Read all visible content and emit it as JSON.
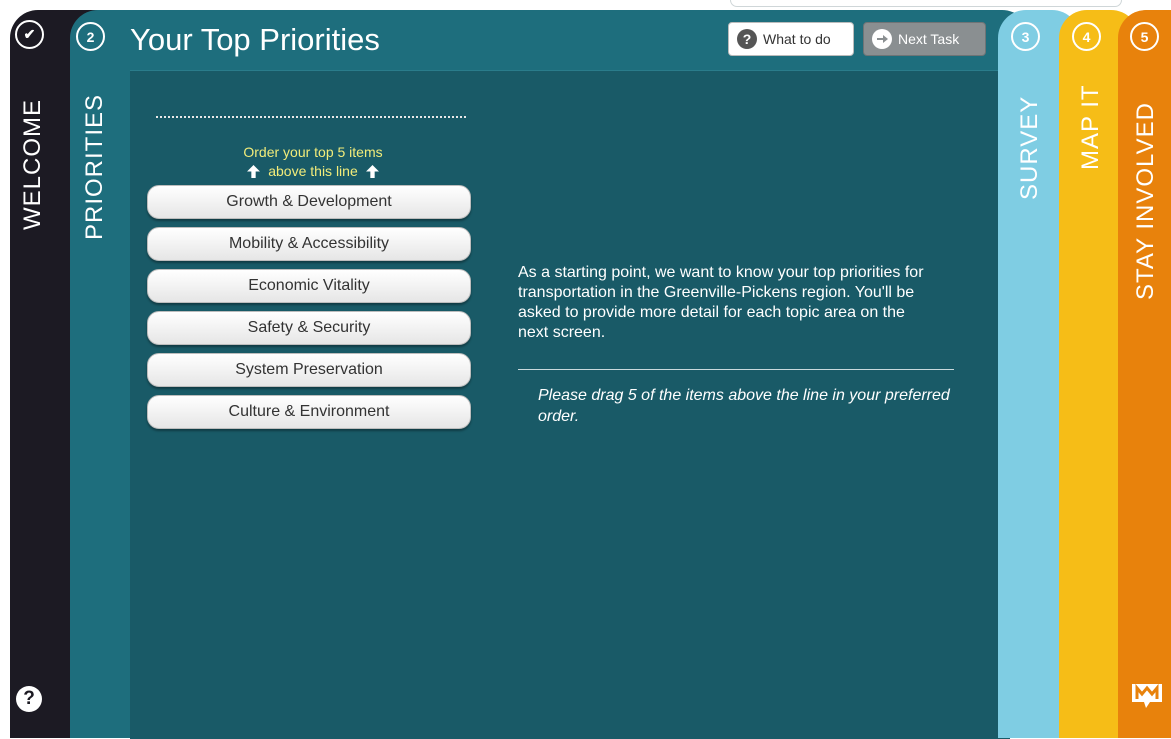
{
  "steps": [
    {
      "key": "welcome",
      "label": "WELCOME",
      "number": "✔"
    },
    {
      "key": "priorities",
      "label": "PRIORITIES",
      "number": "2"
    },
    {
      "key": "survey",
      "label": "SURVEY",
      "number": "3"
    },
    {
      "key": "mapit",
      "label": "MAP IT",
      "number": "4"
    },
    {
      "key": "stay",
      "label": "STAY INVOLVED",
      "number": "5"
    }
  ],
  "header": {
    "title": "Your Top Priorities",
    "what_to_do": "What to do",
    "next_task": "Next Task"
  },
  "ranking": {
    "instruction_line1": "Order your top 5 items",
    "instruction_line2": "above this line",
    "items": [
      "Growth & Development",
      "Mobility & Accessibility",
      "Economic Vitality",
      "Safety & Security",
      "System Preservation",
      "Culture & Environment"
    ]
  },
  "description": "As a starting point, we want to know your top priorities for transportation in the Greenville-Pickens region. You'll be asked to provide more detail for each topic area on the next screen.",
  "instruction": "Please drag 5 of the items above the line in your preferred order.",
  "icons": {
    "help": "question-icon",
    "logo": "metroquest-logo-icon",
    "arrow": "arrow-up-icon",
    "next": "arrow-right-circle-icon"
  },
  "colors": {
    "welcome": "#1c1a23",
    "priorities": "#1e6e7d",
    "content": "#195a67",
    "survey": "#7fcde3",
    "mapit": "#f6bd17",
    "stay": "#e8820c",
    "instruction": "#f2ec7a"
  }
}
